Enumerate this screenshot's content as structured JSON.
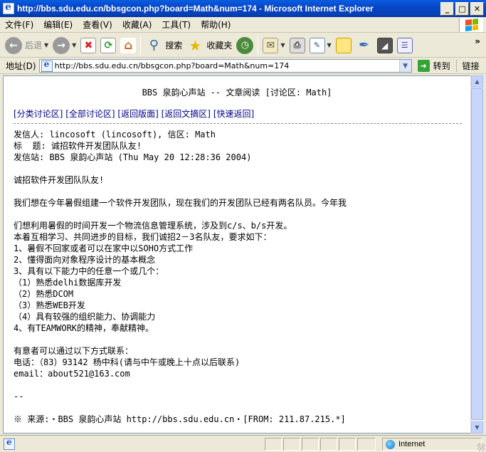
{
  "window": {
    "title": "http://bbs.sdu.edu.cn/bbsgcon.php?board=Math&num=174 - Microsoft Internet Explorer",
    "minimize": "_",
    "maximize": "□",
    "close": "✕"
  },
  "menu": {
    "items": [
      "文件(F)",
      "编辑(E)",
      "查看(V)",
      "收藏(A)",
      "工具(T)",
      "帮助(H)"
    ]
  },
  "toolbar": {
    "back_label": "后退",
    "search_label": "搜索",
    "favorites_label": "收藏夹",
    "more": "»"
  },
  "address": {
    "label": "地址(D)",
    "url": "http://bbs.sdu.edu.cn/bbsgcon.php?board=Math&num=174",
    "go_label": "转到",
    "links_label": "链接"
  },
  "page": {
    "header": "BBS 泉韵心声站 -- 文章阅读 [讨论区: Math]",
    "nav": [
      "[分类讨论区]",
      "[全部讨论区]",
      "[返回版面]",
      "[返回文摘区]",
      "[快速返回]"
    ],
    "article": [
      "发信人: lincosoft (lincosoft), 信区: Math",
      "标  题: 诚招软件开发团队队友!",
      "发信站: BBS 泉韵心声站 (Thu May 20 12:28:36 2004)",
      "",
      "诚招软件开发团队队友!",
      "",
      "我们想在今年暑假组建一个软件开发团队，现在我们的开发团队已经有两名队员。今年我",
      "",
      "们想利用暑假的时间开发一个物流信息管理系统，涉及到c/s、b/s开发。",
      "本着互相学习、共同进步的目标，我们诚招2－3名队友，要求如下：",
      "1、暑假不回家或者可以在家中以SOHO方式工作",
      "2、懂得面向对象程序设计的基本概念",
      "3、具有以下能力中的任意一个或几个：",
      "（1）熟悉delhi数据库开发",
      "（2）熟悉DCOM",
      "（3）熟悉WEB开发",
      "（4）具有较强的组织能力、协调能力",
      "4、有TEAMWORK的精神，奉献精神。",
      "",
      "有意者可以通过以下方式联系：",
      "电话：（83）93142 杨中科(请与中午或晚上十点以后联系)",
      "email：about521@163.com",
      "",
      "--",
      "",
      "※ 来源:・BBS 泉韵心声站 http://bbs.sdu.edu.cn・[FROM: 211.87.215.*]"
    ]
  },
  "status": {
    "zone_label": "Internet"
  }
}
